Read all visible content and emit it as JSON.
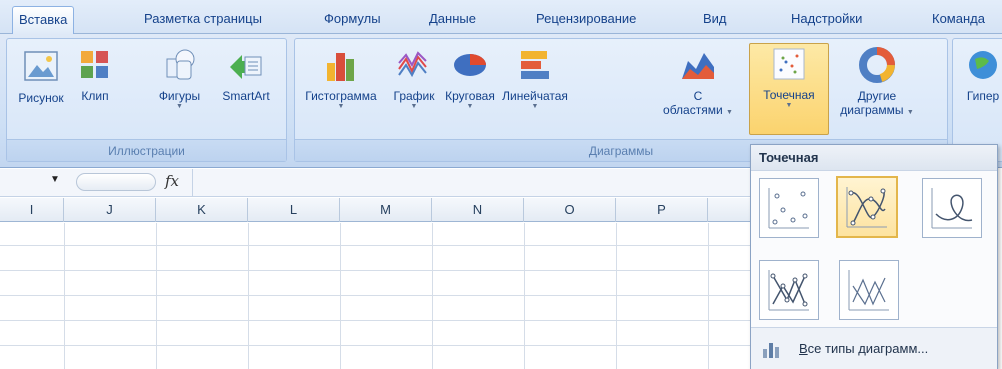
{
  "tabs": [
    {
      "label": "Вставка",
      "active": true
    },
    {
      "label": "Разметка страницы"
    },
    {
      "label": "Формулы"
    },
    {
      "label": "Данные"
    },
    {
      "label": "Рецензирование"
    },
    {
      "label": "Вид"
    },
    {
      "label": "Надстройки"
    },
    {
      "label": "Команда"
    }
  ],
  "groups": {
    "illustrations": {
      "label": "Иллюстрации",
      "buttons": [
        {
          "label": "Рисунок",
          "icon": "picture-icon"
        },
        {
          "label": "Клип",
          "icon": "clipart-icon"
        },
        {
          "label": "Фигуры",
          "icon": "shapes-icon"
        },
        {
          "label": "SmartArt",
          "icon": "smartart-icon"
        }
      ]
    },
    "charts": {
      "label": "Диаграммы",
      "buttons": [
        {
          "label": "Гистограмма",
          "icon": "column-chart-icon"
        },
        {
          "label": "График",
          "icon": "line-chart-icon"
        },
        {
          "label": "Круговая",
          "icon": "pie-chart-icon"
        },
        {
          "label": "Линейчатая",
          "icon": "bar-chart-icon"
        },
        {
          "label1": "С",
          "label2": "областями",
          "icon": "area-chart-icon"
        },
        {
          "label": "Точечная",
          "icon": "scatter-chart-icon",
          "selected": true
        },
        {
          "label1": "Другие",
          "label2": "диаграммы",
          "icon": "other-charts-icon"
        }
      ]
    },
    "links": {
      "label": "Гипер"
    }
  },
  "formula_bar": {
    "fx": "fx"
  },
  "columns": [
    "I",
    "J",
    "K",
    "L",
    "M",
    "N",
    "O",
    "P"
  ],
  "dropdown": {
    "title": "Точечная",
    "footer_underlined": "В",
    "footer_rest": "се типы диаграмм..."
  },
  "colors": {
    "accent": "#15428b",
    "selected": "#fbd36e",
    "ribbon": "#cddff5"
  }
}
